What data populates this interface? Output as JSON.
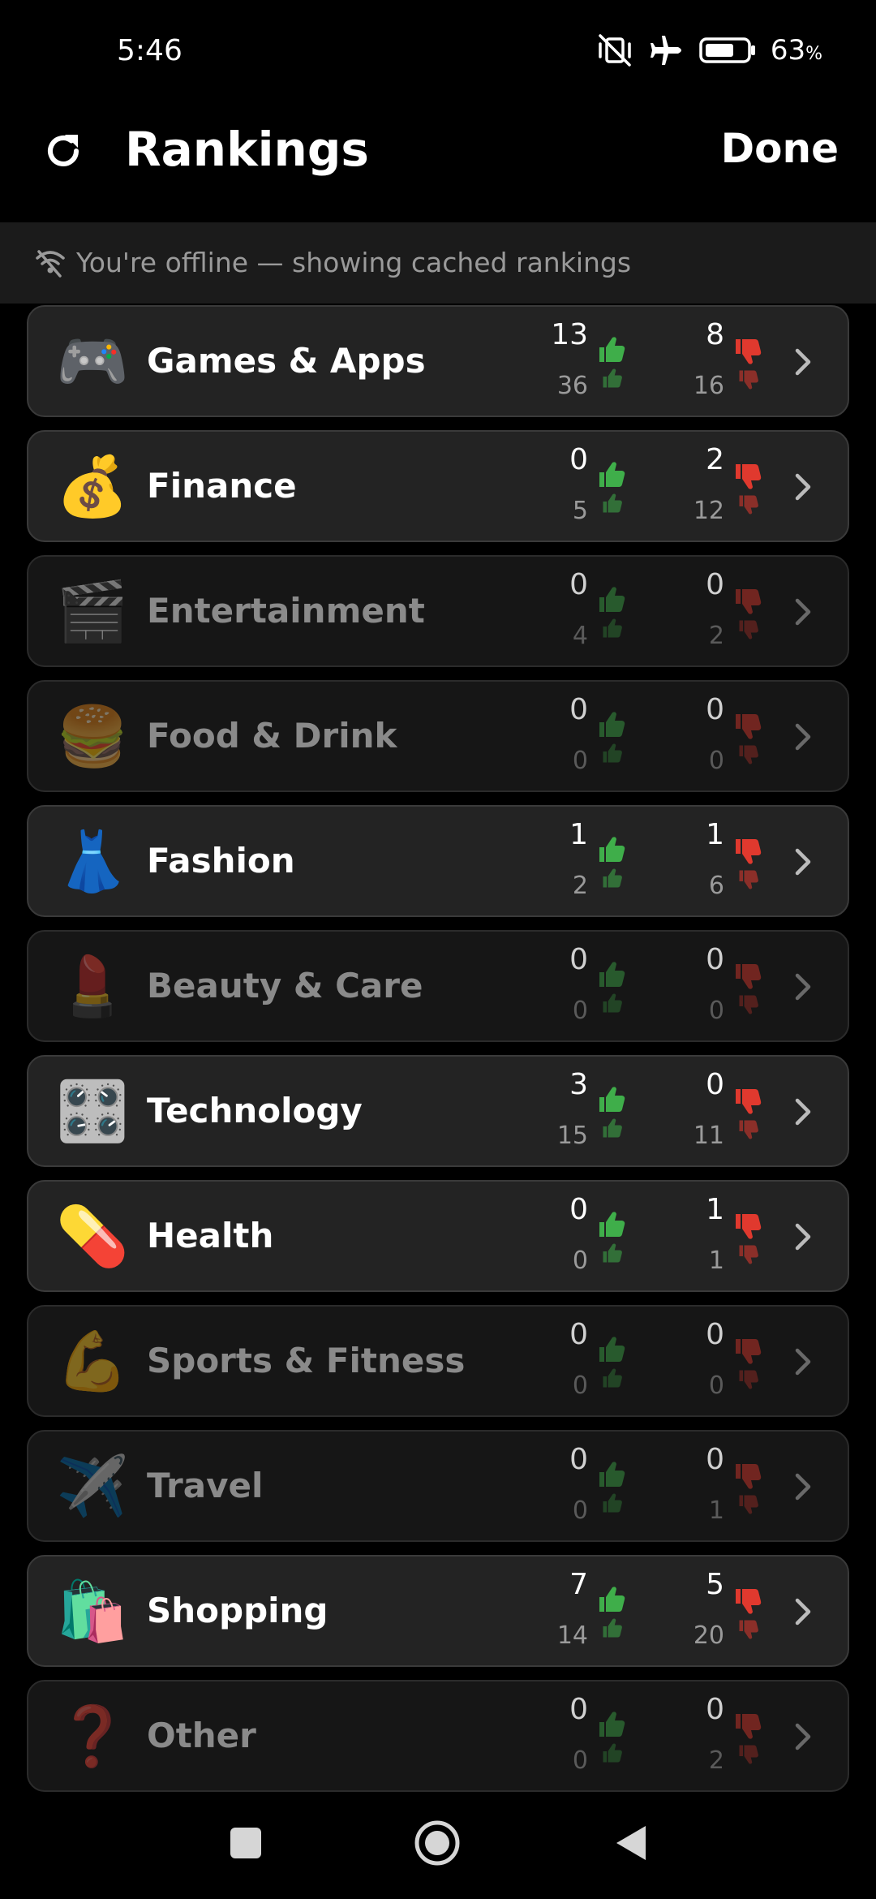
{
  "status_bar": {
    "time": "5:46",
    "battery_percent": "63",
    "battery_symbol": "%",
    "icons": [
      "vibrate-off-icon",
      "airplane-icon",
      "battery-icon"
    ]
  },
  "header": {
    "title": "Rankings",
    "done_label": "Done",
    "refresh_icon": "refresh-icon"
  },
  "offline_banner": {
    "text": "You're offline — showing cached rankings",
    "icon": "wifi-off-icon"
  },
  "colors": {
    "thumbs_up": "#3fae4a",
    "thumbs_down": "#e0392e",
    "card_active": "#232323",
    "card_dim": "#161616"
  },
  "categories": [
    {
      "label": "Games & Apps",
      "emoji": "🎮",
      "icon": "game-controller-icon",
      "up_top": "13",
      "up_bottom": "36",
      "down_top": "8",
      "down_bottom": "16",
      "active": true
    },
    {
      "label": "Finance",
      "emoji": "💰",
      "icon": "money-bag-icon",
      "up_top": "0",
      "up_bottom": "5",
      "down_top": "2",
      "down_bottom": "12",
      "active": true
    },
    {
      "label": "Entertainment",
      "emoji": "🎬",
      "icon": "clapperboard-icon",
      "up_top": "0",
      "up_bottom": "4",
      "down_top": "0",
      "down_bottom": "2",
      "active": false
    },
    {
      "label": "Food & Drink",
      "emoji": "🍔",
      "icon": "burger-icon",
      "up_top": "0",
      "up_bottom": "0",
      "down_top": "0",
      "down_bottom": "0",
      "active": false
    },
    {
      "label": "Fashion",
      "emoji": "👗",
      "icon": "dress-icon",
      "up_top": "1",
      "up_bottom": "2",
      "down_top": "1",
      "down_bottom": "6",
      "active": true
    },
    {
      "label": "Beauty & Care",
      "emoji": "💄",
      "icon": "lipstick-icon",
      "up_top": "0",
      "up_bottom": "0",
      "down_top": "0",
      "down_bottom": "0",
      "active": false
    },
    {
      "label": "Technology",
      "emoji": "🎛️",
      "icon": "control-knobs-icon",
      "up_top": "3",
      "up_bottom": "15",
      "down_top": "0",
      "down_bottom": "11",
      "active": true
    },
    {
      "label": "Health",
      "emoji": "💊",
      "icon": "pill-icon",
      "up_top": "0",
      "up_bottom": "0",
      "down_top": "1",
      "down_bottom": "1",
      "active": true
    },
    {
      "label": "Sports & Fitness",
      "emoji": "💪",
      "icon": "flexed-biceps-icon",
      "up_top": "0",
      "up_bottom": "0",
      "down_top": "0",
      "down_bottom": "0",
      "active": false
    },
    {
      "label": "Travel",
      "emoji": "✈️",
      "icon": "airplane-icon",
      "up_top": "0",
      "up_bottom": "0",
      "down_top": "0",
      "down_bottom": "1",
      "active": false
    },
    {
      "label": "Shopping",
      "emoji": "🛍️",
      "icon": "shopping-bags-icon",
      "up_top": "7",
      "up_bottom": "14",
      "down_top": "5",
      "down_bottom": "20",
      "active": true
    },
    {
      "label": "Other",
      "emoji": "❓",
      "icon": "question-mark-icon",
      "up_top": "0",
      "up_bottom": "0",
      "down_top": "0",
      "down_bottom": "2",
      "active": false
    }
  ],
  "nav_bar": {
    "buttons": [
      "recents-button",
      "home-button",
      "back-button"
    ]
  }
}
